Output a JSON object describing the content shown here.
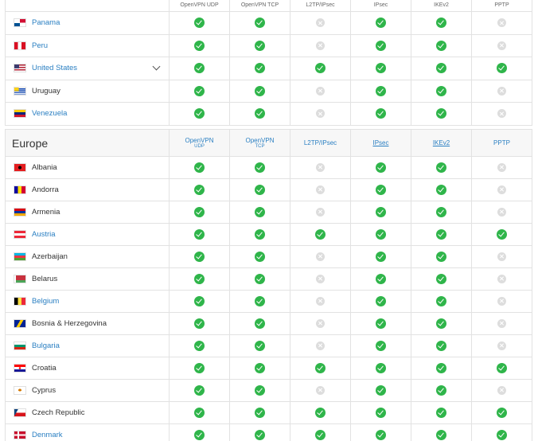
{
  "americas": {
    "headers": [
      "OpenVPN UDP",
      "OpenVPN TCP",
      "L2TP/IPsec",
      "IPsec",
      "IKEv2",
      "PPTP"
    ],
    "rows": [
      {
        "country": "Panama",
        "link": true,
        "flag": "panama-flag-icon",
        "support": [
          true,
          true,
          false,
          true,
          true,
          false
        ]
      },
      {
        "country": "Peru",
        "link": true,
        "flag": "peru-flag-icon",
        "support": [
          true,
          true,
          false,
          true,
          true,
          false
        ]
      },
      {
        "country": "United States",
        "link": true,
        "flag": "united-states-flag-icon",
        "expandable": true,
        "support": [
          true,
          true,
          true,
          true,
          true,
          true
        ]
      },
      {
        "country": "Uruguay",
        "link": false,
        "flag": "uruguay-flag-icon",
        "support": [
          true,
          true,
          false,
          true,
          true,
          false
        ]
      },
      {
        "country": "Venezuela",
        "link": true,
        "flag": "venezuela-flag-icon",
        "support": [
          true,
          true,
          false,
          true,
          true,
          false
        ]
      }
    ]
  },
  "europe": {
    "region": "Europe",
    "headers": [
      {
        "top": "OpenVPN",
        "sub": "UDP"
      },
      {
        "top": "OpenVPN",
        "sub": "TCP"
      },
      {
        "top": "L2TP/IPsec",
        "sub": ""
      },
      {
        "top": "IPsec",
        "sub": ""
      },
      {
        "top": "IKEv2",
        "sub": ""
      },
      {
        "top": "PPTP",
        "sub": ""
      }
    ],
    "rows": [
      {
        "country": "Albania",
        "link": false,
        "flag": "albania-flag-icon",
        "support": [
          true,
          true,
          false,
          true,
          true,
          false
        ]
      },
      {
        "country": "Andorra",
        "link": false,
        "flag": "andorra-flag-icon",
        "support": [
          true,
          true,
          false,
          true,
          true,
          false
        ]
      },
      {
        "country": "Armenia",
        "link": false,
        "flag": "armenia-flag-icon",
        "support": [
          true,
          true,
          false,
          true,
          true,
          false
        ]
      },
      {
        "country": "Austria",
        "link": true,
        "flag": "austria-flag-icon",
        "support": [
          true,
          true,
          true,
          true,
          true,
          true
        ]
      },
      {
        "country": "Azerbaijan",
        "link": false,
        "flag": "azerbaijan-flag-icon",
        "support": [
          true,
          true,
          false,
          true,
          true,
          false
        ]
      },
      {
        "country": "Belarus",
        "link": false,
        "flag": "belarus-flag-icon",
        "support": [
          true,
          true,
          false,
          true,
          true,
          false
        ]
      },
      {
        "country": "Belgium",
        "link": true,
        "flag": "belgium-flag-icon",
        "support": [
          true,
          true,
          false,
          true,
          true,
          false
        ]
      },
      {
        "country": "Bosnia & Herzegovina",
        "link": false,
        "flag": "bosnia-herzegovina-flag-icon",
        "support": [
          true,
          true,
          false,
          true,
          true,
          false
        ]
      },
      {
        "country": "Bulgaria",
        "link": true,
        "flag": "bulgaria-flag-icon",
        "support": [
          true,
          true,
          false,
          true,
          true,
          false
        ]
      },
      {
        "country": "Croatia",
        "link": false,
        "flag": "croatia-flag-icon",
        "support": [
          true,
          true,
          true,
          true,
          true,
          true
        ]
      },
      {
        "country": "Cyprus",
        "link": false,
        "flag": "cyprus-flag-icon",
        "support": [
          true,
          true,
          false,
          true,
          true,
          false
        ]
      },
      {
        "country": "Czech Republic",
        "link": false,
        "flag": "czech-republic-flag-icon",
        "support": [
          true,
          true,
          true,
          true,
          true,
          true
        ]
      },
      {
        "country": "Denmark",
        "link": true,
        "flag": "denmark-flag-icon",
        "support": [
          true,
          true,
          true,
          true,
          true,
          true
        ]
      }
    ]
  },
  "colors": {
    "supported": "#2fb54a",
    "unsupported": "#dddddd",
    "link": "#2a7fc2"
  }
}
